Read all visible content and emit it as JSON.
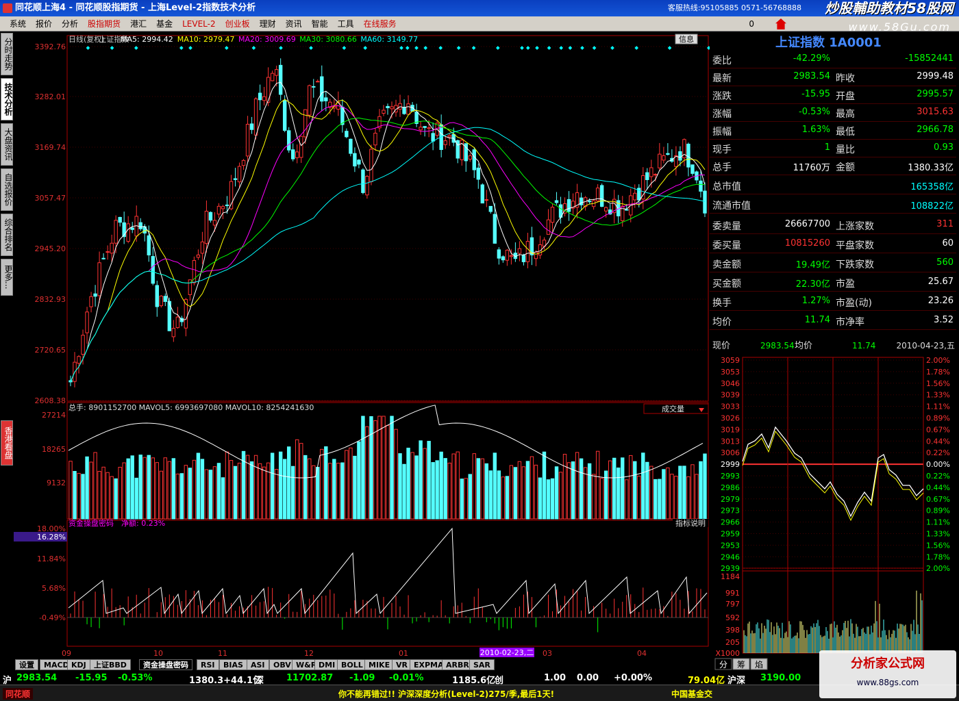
{
  "titlebar": {
    "title": "同花顺上海4 - 同花顺股指期货 - 上海Level-2指数技术分析",
    "hotline": "客服热线:95105885 0571-56768888",
    "watermark1": "炒股輔助教材58股网",
    "watermark2": "www.58Gu.com"
  },
  "menu": {
    "items": [
      "系统",
      "报价",
      "分析",
      "股指期货",
      "港汇",
      "基金",
      "LEVEL-2",
      "创业板",
      "理财",
      "资讯",
      "智能",
      "工具",
      "在线服务"
    ],
    "count": "0"
  },
  "sidetabs": [
    "分时走势",
    "技术分析",
    "大盘资讯",
    "自选报价",
    "综合排名",
    "更多..."
  ],
  "sidetab_red": "香港看盘",
  "main": {
    "legend_prefix": "日线(复权)",
    "index_name": "上证指数",
    "ma5": "MA5: 2994.42",
    "ma10": "MA10: 2979.47",
    "ma20": "MA20: 3009.69",
    "ma30": "MA30: 3080.66",
    "ma60": "MA60: 3149.77",
    "info_btn": "信息",
    "price_ticks": [
      "3392.76",
      "3282.01",
      "3169.74",
      "3057.47",
      "2945.20",
      "2832.93",
      "2720.65",
      "2608.38"
    ],
    "vol_legend": "总手: 8901152700 MAVOL5: 6993697080 MAVOL10: 8254241630",
    "vol_selector": "成交量",
    "vol_ticks": [
      "27214",
      "18265",
      "9132"
    ],
    "ind_legend_name": "资金操盘密码",
    "ind_legend_val": "净额: 0.23%",
    "ind_btn": "指标说明",
    "ind_ticks": [
      "18.00%",
      "11.84%",
      "5.68%",
      "-0.49%"
    ],
    "ind_cursor": "16.28%",
    "date_ticks": [
      "09",
      "10",
      "11",
      "12",
      "01",
      "02",
      "03",
      "04"
    ],
    "date_cursor": "2010-02-23,二"
  },
  "indicator_tabs": [
    "设置",
    "MACD",
    "KDJ",
    "上证BBD",
    "资金操盘密码",
    "RSI",
    "BIAS",
    "ASI",
    "OBV",
    "W&R",
    "DMI",
    "BOLL",
    "MIKE",
    "VR",
    "EXPMA",
    "ARBR",
    "SAR"
  ],
  "right": {
    "stock_title": "上证指数 1A0001",
    "rows": [
      {
        "l": "委比",
        "v": "-42.29%",
        "l2": "",
        "v2": "-15852441"
      },
      {
        "l": "最新",
        "v": "2983.54",
        "l2": "昨收",
        "v2": "2999.48"
      },
      {
        "l": "涨跌",
        "v": "-15.95",
        "l2": "开盘",
        "v2": "2995.57"
      },
      {
        "l": "涨幅",
        "v": "-0.53%",
        "l2": "最高",
        "v2": "3015.63"
      },
      {
        "l": "振幅",
        "v": "1.63%",
        "l2": "最低",
        "v2": "2966.78"
      },
      {
        "l": "现手",
        "v": "1",
        "l2": "量比",
        "v2": "0.93"
      },
      {
        "l": "总手",
        "v": "11760万",
        "l2": "金额",
        "v2": "1380.33亿"
      },
      {
        "l": "总市值",
        "v": "",
        "l2": "",
        "v2": "165358亿"
      },
      {
        "l": "流通市值",
        "v": "",
        "l2": "",
        "v2": "108822亿"
      },
      {
        "l": "委卖量",
        "v": "26667700",
        "l2": "上涨家数",
        "v2": "311"
      },
      {
        "l": "委买量",
        "v": "10815260",
        "l2": "平盘家数",
        "v2": "60"
      },
      {
        "l": "卖金额",
        "v": "19.49亿",
        "l2": "下跌家数",
        "v2": "560"
      },
      {
        "l": "买金额",
        "v": "22.30亿",
        "l2": "市盈",
        "v2": "25.67"
      },
      {
        "l": "换手",
        "v": "1.27%",
        "l2": "市盈(动)",
        "v2": "23.26"
      },
      {
        "l": "均价",
        "v": "11.74",
        "l2": "市净率",
        "v2": "3.52"
      }
    ],
    "mini_header": {
      "l": "现价",
      "v": "2983.54",
      "l2": "均价",
      "v2": "11.74",
      "date": "2010-04-23,五"
    },
    "mini_left": [
      "3059",
      "3053",
      "3046",
      "3039",
      "3033",
      "3026",
      "3019",
      "3013",
      "3006",
      "2999",
      "2993",
      "2986",
      "2979",
      "2973",
      "2966",
      "2959",
      "2953",
      "2946",
      "2939"
    ],
    "mini_right": [
      "2.00%",
      "1.78%",
      "1.56%",
      "1.33%",
      "1.11%",
      "0.89%",
      "0.67%",
      "0.44%",
      "0.22%",
      "0.00%",
      "0.22%",
      "0.44%",
      "0.67%",
      "0.89%",
      "1.11%",
      "1.33%",
      "1.56%",
      "1.78%",
      "2.00%"
    ],
    "mini_vol": [
      "1184",
      "991",
      "797",
      "592",
      "398",
      "205"
    ],
    "mini_unit": "X1000",
    "mini_tabs": [
      "分",
      "筹",
      "焰"
    ]
  },
  "status": {
    "sh_label": "沪",
    "sh_price": "2983.54",
    "sh_chg": "-15.95",
    "sh_pct": "-0.53%",
    "sh_amt": "1380.3+44.1亿",
    "sz_label": "深",
    "sz_price": "11702.87",
    "sz_chg": "-1.09",
    "sz_pct": "-0.01%",
    "sz_amt": "1185.6亿",
    "cy_label": "创",
    "cy_a": "1.00",
    "cy_b": "0.00",
    "cy_c": "+0.00%",
    "hs_val": "79.04亿",
    "hs_label": "沪深",
    "hs_price": "3190.00"
  },
  "bottom": {
    "logo": "同花顺",
    "ticker": "你不能再错过!! 沪深深度分析(Level-2)275/季,最后1天!",
    "right": "中国基金交",
    "badge": "分析家公式网",
    "badge2": "www.88gs.com"
  }
}
